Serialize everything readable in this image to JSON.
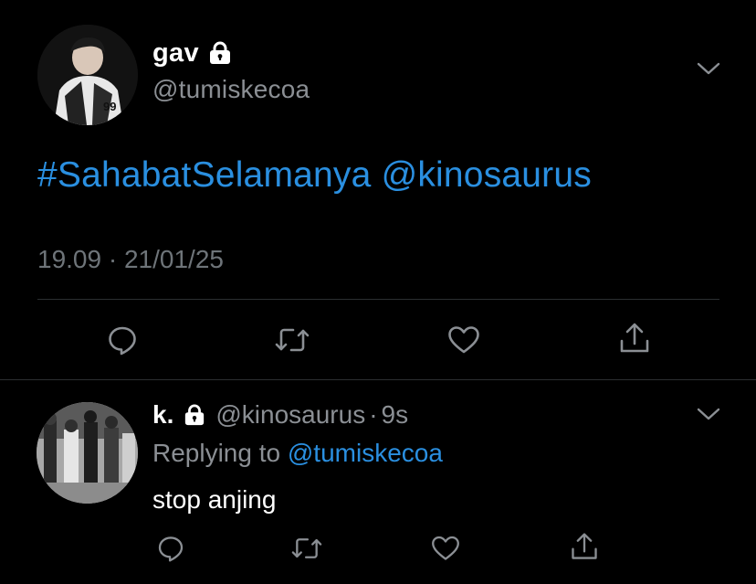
{
  "tweet": {
    "author_name": "gav",
    "author_handle": "@tumiskecoa",
    "text_hashtag": "#SahabatSelamanya",
    "text_mention": "@kinosaurus",
    "time": "19.09",
    "separator": "·",
    "date": "21/01/25"
  },
  "reply": {
    "author_name": "k.",
    "author_handle": "@kinosaurus",
    "separator": "·",
    "age": "9s",
    "replying_prefix": "Replying to",
    "replying_to": "@tumiskecoa",
    "text": "stop anjing"
  },
  "icons": {
    "lock": "lock-icon",
    "more": "chevron-down-icon",
    "reply": "reply-bubble-icon",
    "retweet": "retweet-icon",
    "like": "heart-icon",
    "share": "share-icon"
  },
  "colors": {
    "background": "#000000",
    "link": "#2a8fe0",
    "muted": "#8b8f94",
    "icon": "#8b8f94"
  }
}
